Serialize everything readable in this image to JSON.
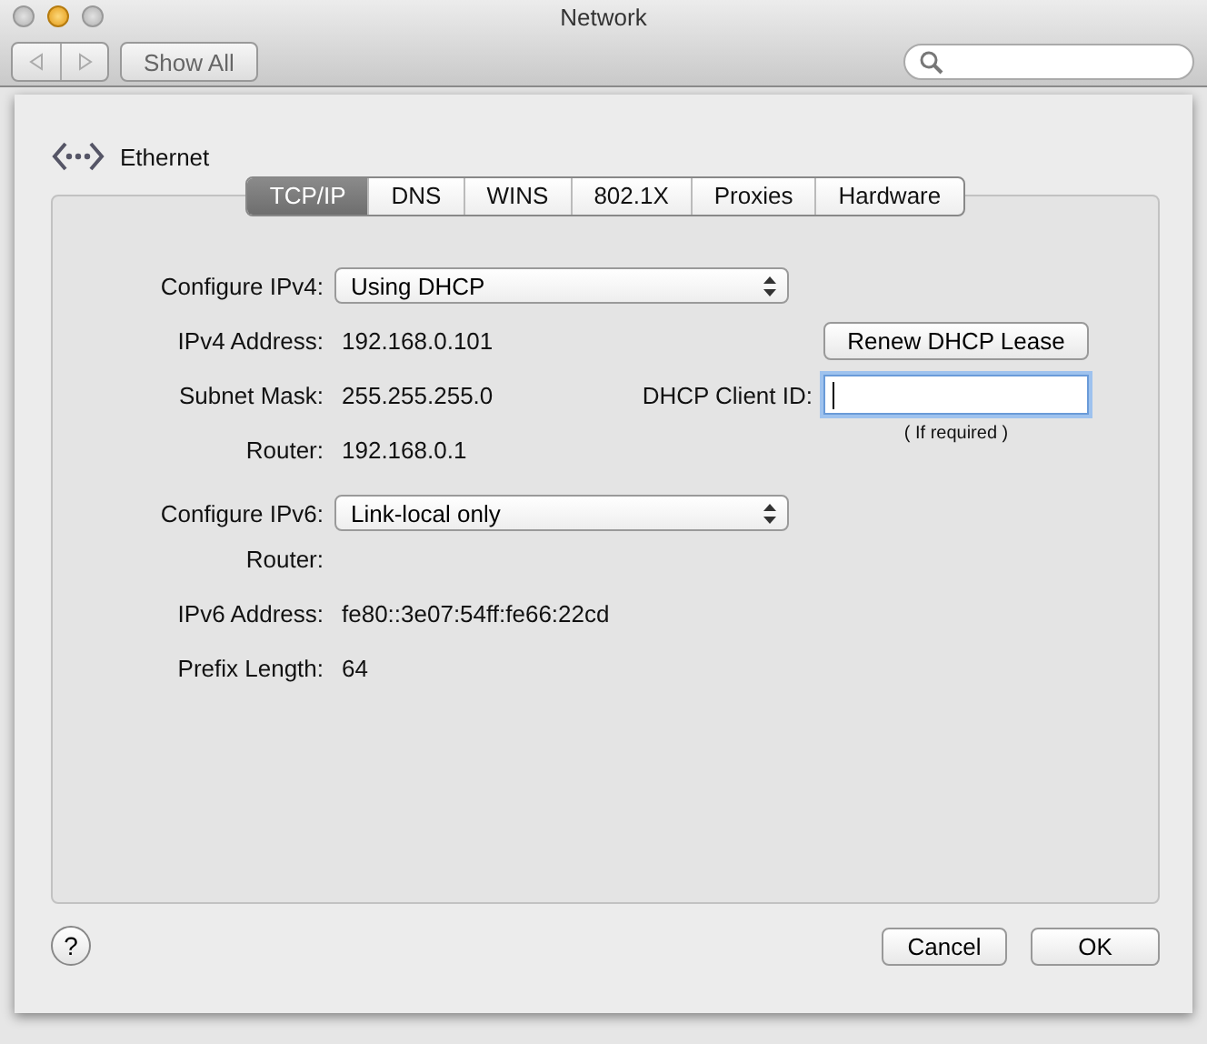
{
  "window": {
    "title": "Network"
  },
  "toolbar": {
    "show_all_button": "Show All"
  },
  "interface": {
    "name": "Ethernet"
  },
  "tabs": [
    {
      "label": "TCP/IP",
      "selected": true
    },
    {
      "label": "DNS",
      "selected": false
    },
    {
      "label": "WINS",
      "selected": false
    },
    {
      "label": "802.1X",
      "selected": false
    },
    {
      "label": "Proxies",
      "selected": false
    },
    {
      "label": "Hardware",
      "selected": false
    }
  ],
  "ipv4": [
    {
      "kind": "popup",
      "label": "Configure IPv4:",
      "value": "Using DHCP"
    },
    {
      "kind": "value",
      "label": "IPv4 Address:",
      "value": "192.168.0.101"
    },
    {
      "kind": "value",
      "label": "Subnet Mask:",
      "value": "255.255.255.0"
    },
    {
      "kind": "value",
      "label": "Router:",
      "value": "192.168.0.1"
    }
  ],
  "dhcp": {
    "renew_button": "Renew DHCP Lease",
    "client_id": {
      "label": "DHCP Client ID:",
      "focused": true,
      "hint": "( If required )"
    }
  },
  "ipv6": [
    {
      "kind": "popup",
      "label": "Configure IPv6:",
      "value": "Link-local only"
    },
    {
      "kind": "value",
      "label": "Router:"
    },
    {
      "kind": "value",
      "label": "IPv6 Address:",
      "value": "fe80::3e07:54ff:fe66:22cd"
    },
    {
      "kind": "value",
      "label": "Prefix Length:",
      "value": "64"
    }
  ],
  "help_button": "?",
  "buttons": [
    "Cancel",
    "OK"
  ]
}
